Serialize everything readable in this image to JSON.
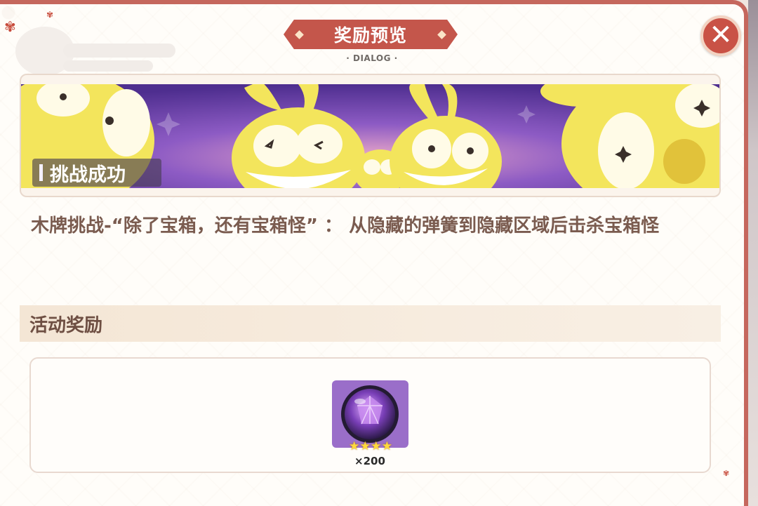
{
  "dialog": {
    "title": "奖励预览",
    "subtitle": "· DIALOG ·",
    "close_icon": "close-x-icon"
  },
  "banner": {
    "tag": "挑战成功",
    "art": "yellow-bunny-mascots-on-purple-background"
  },
  "description": "木牌挑战-“除了宝箱，还有宝箱怪” ： 从隐藏的弹簧到隐藏区域后击杀宝箱怪",
  "section": {
    "title": "活动奖励"
  },
  "reward": {
    "icon": "purple-gem-orb-icon",
    "stars": [
      "★",
      "★",
      "★",
      "★"
    ],
    "count": "×200"
  },
  "colors": {
    "accent": "#c4564b",
    "frame": "#c5675d",
    "text": "#7a5b4f",
    "item_bg": "#9a6ec9",
    "star": "#ffd93d"
  }
}
